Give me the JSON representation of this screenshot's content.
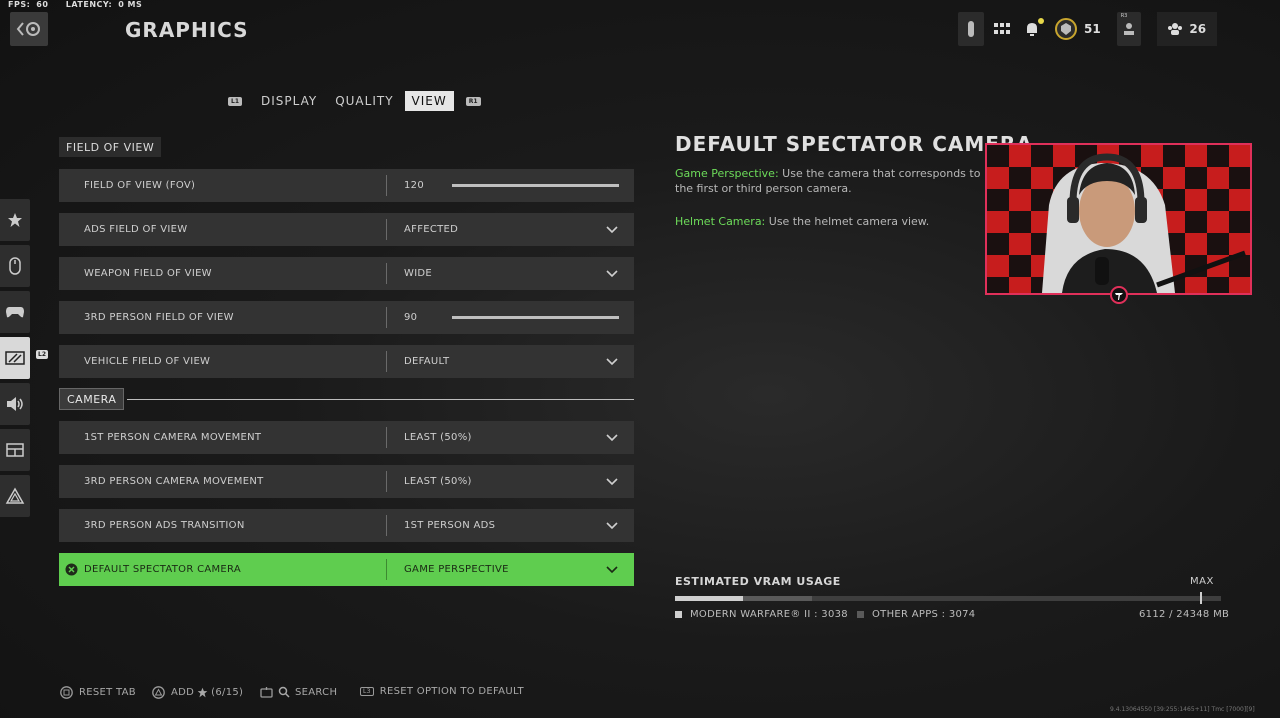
{
  "stats": {
    "fps_label": "FPS:",
    "fps_value": "60",
    "latency_label": "LATENCY:",
    "latency_value": "0 MS"
  },
  "header": {
    "title": "GRAPHICS"
  },
  "topbar": {
    "level": "51",
    "friends_count": "26",
    "r3_hint": "R3"
  },
  "tabs": {
    "left_hint": "L1",
    "right_hint": "R1",
    "items": [
      {
        "label": "DISPLAY"
      },
      {
        "label": "QUALITY"
      },
      {
        "label": "VIEW"
      }
    ],
    "active": "VIEW"
  },
  "rail": {
    "hint": "L2",
    "items": [
      "favorites-star",
      "mouse",
      "controller",
      "graphics",
      "audio",
      "interface",
      "account"
    ]
  },
  "sections": [
    {
      "title": "FIELD OF VIEW"
    },
    {
      "title": "CAMERA"
    }
  ],
  "settings": [
    {
      "name": "FIELD OF VIEW (FOV)",
      "value": "120",
      "type": "slider",
      "level": 1.0
    },
    {
      "name": "ADS FIELD OF VIEW",
      "value": "AFFECTED",
      "type": "dropdown"
    },
    {
      "name": "WEAPON FIELD OF VIEW",
      "value": "WIDE",
      "type": "dropdown"
    },
    {
      "name": "3RD PERSON FIELD OF VIEW",
      "value": "90",
      "type": "slider",
      "level": 1.0
    },
    {
      "name": "VEHICLE FIELD OF VIEW",
      "value": "DEFAULT",
      "type": "dropdown"
    },
    {
      "name": "1ST PERSON CAMERA MOVEMENT",
      "value": "LEAST (50%)",
      "type": "dropdown"
    },
    {
      "name": "3RD PERSON CAMERA MOVEMENT",
      "value": "LEAST (50%)",
      "type": "dropdown"
    },
    {
      "name": "3RD PERSON ADS TRANSITION",
      "value": "1ST PERSON ADS",
      "type": "dropdown"
    },
    {
      "name": "DEFAULT SPECTATOR CAMERA",
      "value": "GAME PERSPECTIVE",
      "type": "dropdown",
      "selected": true
    }
  ],
  "description": {
    "title": "DEFAULT SPECTATOR CAMERA",
    "p1_highlight": "Game Perspective:",
    "p1_text": " Use the camera that corresponds to the first or third person camera.",
    "p2_highlight": "Helmet Camera:",
    "p2_text": " Use the helmet camera view."
  },
  "vram": {
    "title": "ESTIMATED VRAM USAGE",
    "max_label": "MAX",
    "game_label": "MODERN WARFARE® II : 3038",
    "other_label": "OTHER APPS : 3074",
    "total_label": "6112 / 24348 MB",
    "game_fraction": 0.1248,
    "other_fraction": 0.1262
  },
  "footer": {
    "reset_tab": "RESET TAB",
    "add_label": "ADD",
    "add_count": "(6/15)",
    "search": "SEARCH",
    "reset_option_hint": "L3",
    "reset_option": "RESET OPTION TO DEFAULT"
  },
  "version": "9.4.13064550 [39:255:1465+11] Tmc [7000][9]",
  "colors": {
    "accent_green": "#5fcd4f",
    "highlight_text": "#6ddc5a",
    "cam_border": "#e0305a"
  }
}
